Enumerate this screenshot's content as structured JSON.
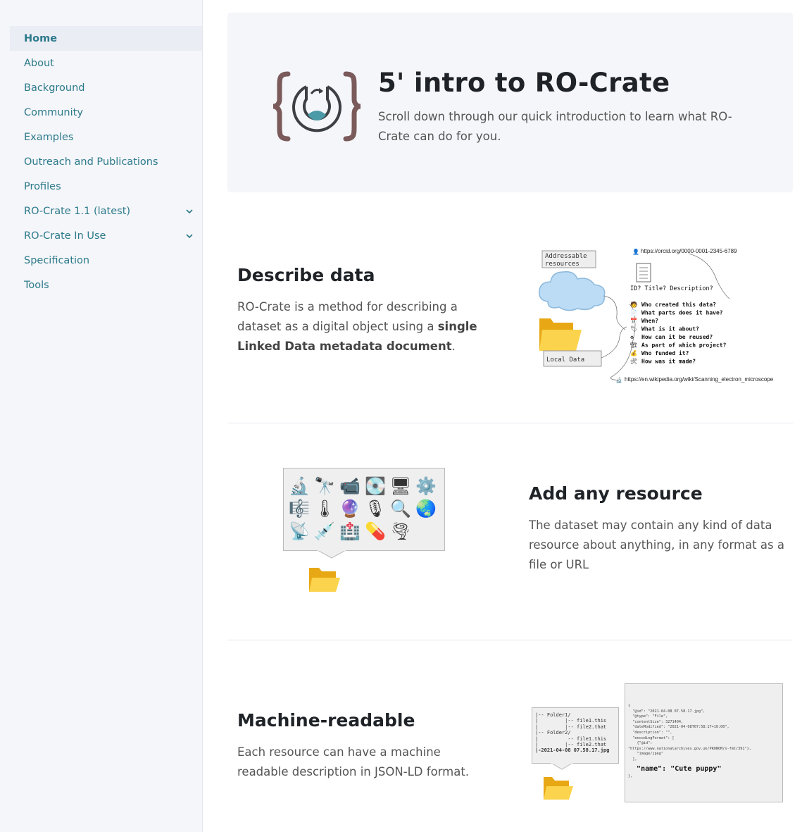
{
  "sidebar": {
    "items": [
      {
        "label": "Home",
        "active": true
      },
      {
        "label": "About"
      },
      {
        "label": "Background"
      },
      {
        "label": "Community"
      },
      {
        "label": "Examples"
      },
      {
        "label": "Outreach and Publications"
      },
      {
        "label": "Profiles"
      },
      {
        "label": "RO-Crate 1.1 (latest)",
        "expandable": true
      },
      {
        "label": "RO-Crate In Use",
        "expandable": true
      },
      {
        "label": "Specification"
      },
      {
        "label": "Tools"
      }
    ]
  },
  "hero": {
    "title": "5' intro to RO-Crate",
    "text": "Scroll down through our quick introduction to learn what RO-Crate can do for you."
  },
  "describe": {
    "title": "Describe data",
    "text_before": "RO-Crate is a method for describing a dataset as a digital object using a ",
    "text_bold": "single Linked Data metadata document",
    "text_after": ".",
    "diagram": {
      "addressable": "Addressable resources",
      "local": "Local Data",
      "orcid": "https://orcid.org/0000-0001-2345-6789",
      "questions_header": "ID? Title? Description?",
      "questions": [
        "Who created this data?",
        "What parts does it have?",
        "When?",
        "What is it about?",
        "How can it be reused?",
        "As part of which project?",
        "Who funded it?",
        "How was it made?"
      ],
      "wiki": "https://en.wikipedia.org/wiki/Scanning_electron_microscope"
    }
  },
  "resource": {
    "title": "Add any resource",
    "text": "The dataset may contain any kind of data resource about anything, in any format as a file or URL",
    "icons": [
      "🔬",
      "🔭",
      "📹",
      "💽",
      "🖥",
      "⚙️",
      "🎼",
      "🌡",
      "🔮",
      "🎙",
      "🔍",
      "🌏",
      "📡",
      "💉",
      "🏥",
      "💊",
      "🌪"
    ]
  },
  "machine": {
    "title": "Machine-readable",
    "text": "Each resource can have a machine readable description in JSON-LD format.",
    "tree": [
      "|-- Folder1/",
      "|         |-- file1.this",
      "|         |-- file2.that",
      "|-- Folder2/",
      "|          -- file1.this",
      "|         |-- file2.that",
      "|-2021-04-08 07.58.17.jpg"
    ],
    "json_lines": [
      "{",
      "  \"@id\": \"2021-04-08 07.58.17.jpg\",",
      "  \"@type\": \"File\",",
      "  \"contentSize\": 3271404,",
      "  \"dateModified\": \"2021-04-08T07:58:17+10:00\",",
      "  \"description\": \"\",",
      "  \"encodingFormat\": [",
      "    {\"@id\":",
      "\"https://www.nationalarchives.gov.uk/PRONOM/x-fmt/391\"},",
      "    \"image/jpeg\"",
      "  ],"
    ],
    "json_name_key": "\"name\"",
    "json_name_val": "\"Cute puppy\"",
    "json_close": "},"
  }
}
